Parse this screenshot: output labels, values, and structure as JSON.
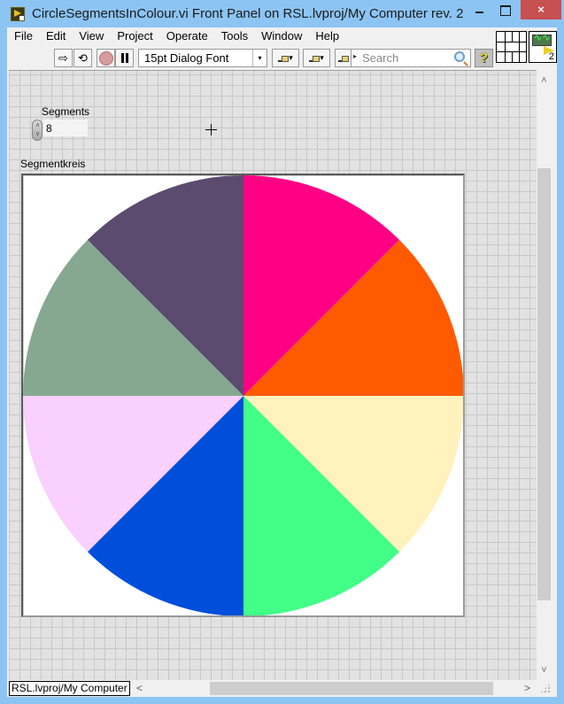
{
  "window": {
    "title": "CircleSegmentsInColour.vi Front Panel on RSL.lvproj/My Computer rev. 2",
    "close_glyph": "×"
  },
  "menu": [
    "File",
    "Edit",
    "View",
    "Project",
    "Operate",
    "Tools",
    "Window",
    "Help"
  ],
  "toolbar": {
    "run_glyph": "⇨",
    "run_continuous_glyph": "⟲",
    "font_select": "15pt Dialog Font",
    "dropdown_glyph": "▾",
    "search_placeholder": "Search",
    "help_glyph": "?",
    "connector_pane_number": "2"
  },
  "front_panel": {
    "segments_control": {
      "label": "Segments",
      "value": "8",
      "up_glyph": "∧",
      "down_glyph": "∨"
    },
    "picture_indicator": {
      "label": "Segmentkreis",
      "segment_count": 8,
      "segments": [
        {
          "index": 0,
          "start_deg": 0,
          "end_deg": 45,
          "color": "#ff0085"
        },
        {
          "index": 1,
          "start_deg": 45,
          "end_deg": 90,
          "color": "#ff5a00"
        },
        {
          "index": 2,
          "start_deg": 90,
          "end_deg": 135,
          "color": "#fff2bc"
        },
        {
          "index": 3,
          "start_deg": 135,
          "end_deg": 180,
          "color": "#41ff87"
        },
        {
          "index": 4,
          "start_deg": 180,
          "end_deg": 225,
          "color": "#004fdb"
        },
        {
          "index": 5,
          "start_deg": 225,
          "end_deg": 270,
          "color": "#f9d0ff"
        },
        {
          "index": 6,
          "start_deg": 270,
          "end_deg": 315,
          "color": "#86a891"
        },
        {
          "index": 7,
          "start_deg": 315,
          "end_deg": 360,
          "color": "#5b4b6f"
        }
      ]
    }
  },
  "statusbar": {
    "context": "RSL.lvproj/My Computer"
  },
  "scrollbars": {
    "up_glyph": "˄",
    "down_glyph": "˅",
    "left_glyph": "<",
    "right_glyph": ">"
  }
}
